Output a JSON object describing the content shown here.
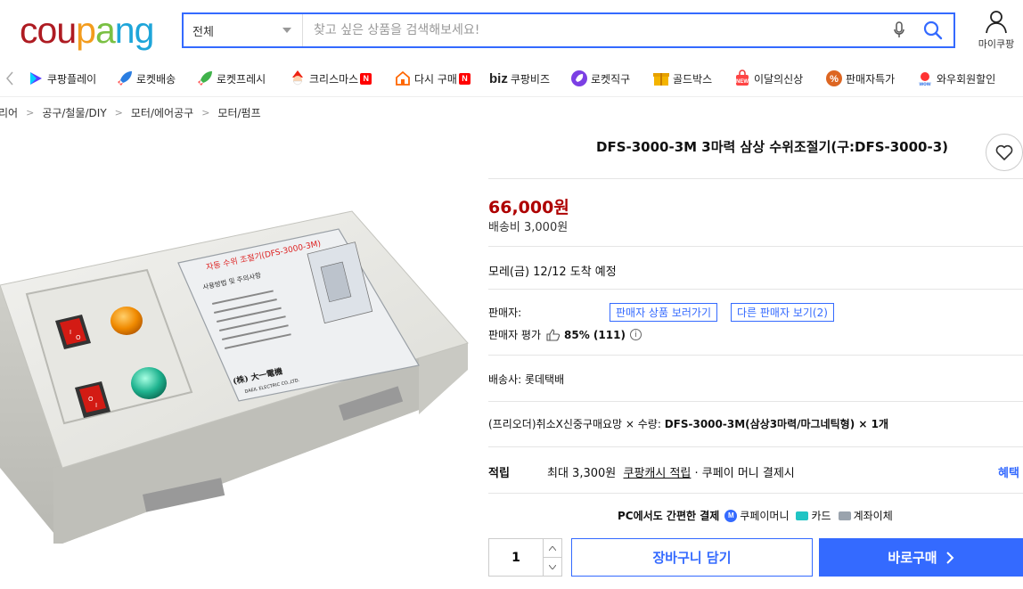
{
  "header": {
    "logo": {
      "letters": [
        "c",
        "o",
        "u",
        "p",
        "a",
        "n",
        "g"
      ],
      "colors": [
        "#ae1b22",
        "#ae1b22",
        "#ae1b22",
        "#f39c1d",
        "#7ac043",
        "#1ea5d9",
        "#1ea5d9"
      ]
    },
    "search": {
      "category": "전체",
      "placeholder": "찾고 싶은 상품을 검색해보세요!"
    },
    "my_coupang": "마이쿠팡",
    "accent_color": "#346aff"
  },
  "nav": {
    "items": [
      {
        "label": "쿠팡플레이",
        "icon": "play-icon"
      },
      {
        "label": "로켓배송",
        "icon": "rocket-icon"
      },
      {
        "label": "로켓프레시",
        "icon": "rocket-fresh-icon"
      },
      {
        "label": "크리스마스",
        "icon": "santa-icon",
        "badge": "N"
      },
      {
        "label": "다시 구매",
        "icon": "reorder-icon",
        "badge": "N"
      },
      {
        "label": "쿠팡비즈",
        "icon": "biz-icon",
        "prefix": "biz"
      },
      {
        "label": "로켓직구",
        "icon": "global-icon"
      },
      {
        "label": "골드박스",
        "icon": "goldbox-icon"
      },
      {
        "label": "이달의신상",
        "icon": "new-bag-icon"
      },
      {
        "label": "판매자특가",
        "icon": "discount-icon"
      },
      {
        "label": "와우회원할인",
        "icon": "wow-icon"
      }
    ]
  },
  "breadcrumb": [
    "리어",
    "공구/철물/DIY",
    "모터/에어공구",
    "모터/펌프"
  ],
  "product": {
    "title": "DFS-3000-3M 3마력 삼상 수위조절기(구:DFS-3000-3)",
    "price": "66,000원",
    "shipping_fee": "배송비 3,000원",
    "arrival": "모레(금) 12/12 도착 예정",
    "seller_label": "판매자:",
    "seller_store_btn": "판매자 상품 보러가기",
    "other_sellers_btn": "다른 판매자 보기(2)",
    "seller_rating_label": "판매자 평가",
    "seller_rating_value": "85% (111)",
    "courier": "배송사:  롯데택배",
    "option_prefix": "(프리오더)취소X신중구매요망 × 수량: ",
    "option_value": "DFS-3000-3M(삼상3마력/마그네틱형) × 1개",
    "reward_label": "적립",
    "reward_text_1": "최대 3,300원",
    "reward_text_2": "쿠팡캐시 적립",
    "reward_text_3": " · 쿠페이 머니 결제시",
    "benefit_link": "혜택",
    "pay_pc": "PC에서도 간편한 결제",
    "pay_methods": [
      "쿠페이머니",
      "카드",
      "계좌이체"
    ],
    "quantity": "1",
    "cart_button": "장바구니 담기",
    "buy_button": "바로구매",
    "device_label_lines": [
      "자동 수위 조절기(DFS-3000-3M)",
      "사용방법 및 주의사항",
      "(株) 大一電機",
      "DAEIL ELECTRIC CO.,LTD."
    ],
    "price_color": "#ae0000"
  }
}
